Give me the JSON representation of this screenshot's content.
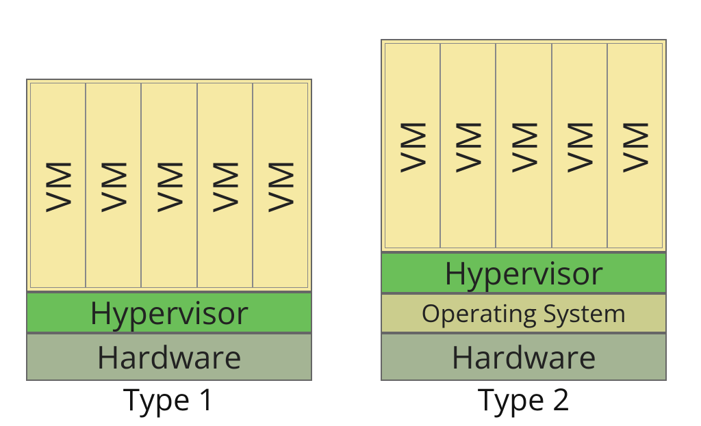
{
  "diagrams": [
    {
      "caption": "Type 1",
      "layers": [
        {
          "kind": "hardware",
          "label": "Hardware"
        },
        {
          "kind": "hyper",
          "label": "Hypervisor"
        },
        {
          "kind": "vmrow",
          "vms": [
            "VM",
            "VM",
            "VM",
            "VM",
            "VM"
          ]
        }
      ]
    },
    {
      "caption": "Type 2",
      "layers": [
        {
          "kind": "hardware",
          "label": "Hardware"
        },
        {
          "kind": "os",
          "label": "Operating System"
        },
        {
          "kind": "hyper",
          "label": "Hypervisor"
        },
        {
          "kind": "vmrow",
          "vms": [
            "VM",
            "VM",
            "VM",
            "VM",
            "VM"
          ]
        }
      ]
    }
  ],
  "colors": {
    "hardware": "#a4b494",
    "os": "#cbcd8d",
    "hypervisor": "#6bbf59",
    "vm": "#f6e9a4"
  }
}
